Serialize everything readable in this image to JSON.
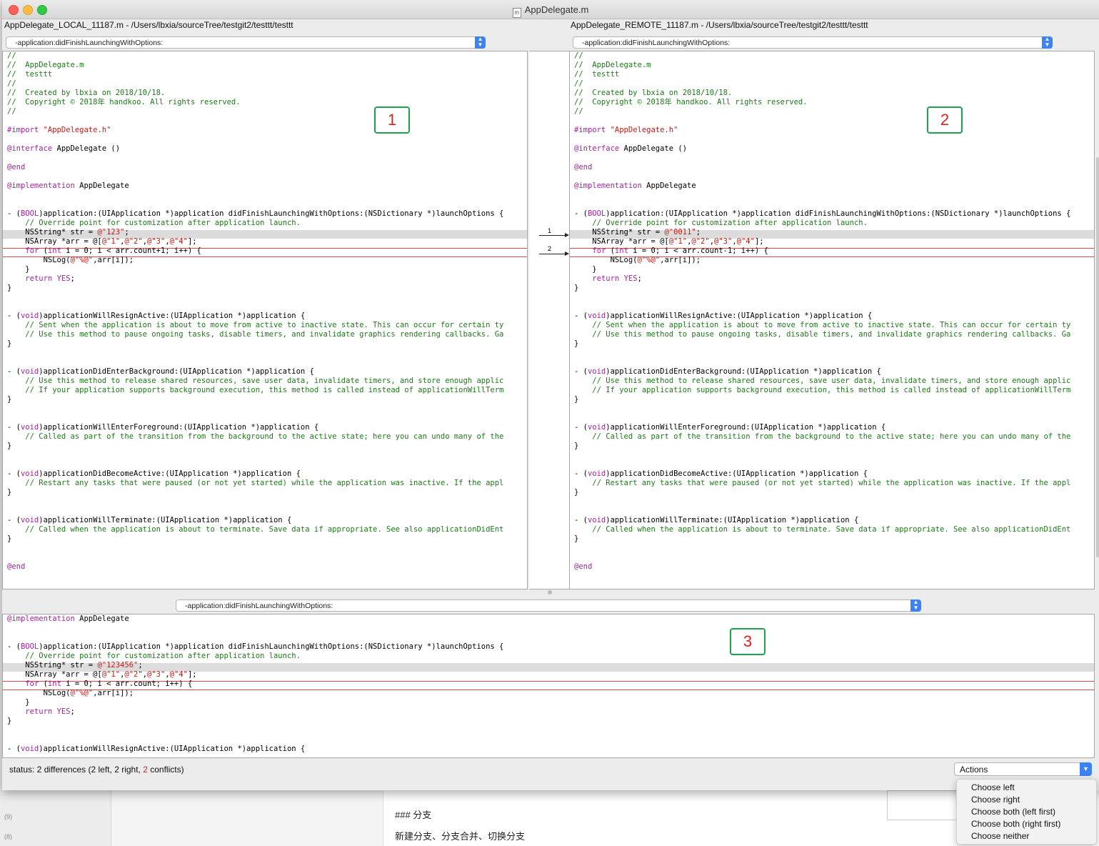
{
  "window": {
    "title": "AppDelegate.m",
    "doc_icon": "m"
  },
  "left": {
    "path": "AppDelegate_LOCAL_11187.m - /Users/lbxia/sourceTree/testgit2/testtt/testtt",
    "function_popup": "-application:didFinishLaunchingWithOptions:",
    "tag": "1"
  },
  "right": {
    "path": "AppDelegate_REMOTE_11187.m - /Users/lbxia/sourceTree/testgit2/testtt/testtt",
    "function_popup": "-application:didFinishLaunchingWithOptions:",
    "tag": "2"
  },
  "merge": {
    "function_popup": "-application:didFinishLaunchingWithOptions:",
    "tag": "3"
  },
  "gutter": {
    "diff1": "1",
    "diff2": "2"
  },
  "status": {
    "prefix": "status:  2 differences  (2 left,  2 right,  ",
    "conflicts": "2",
    "suffix": " conflicts)"
  },
  "actions": {
    "label": "Actions",
    "items": [
      "Choose left",
      "Choose right",
      "Choose both (left first)",
      "Choose both (right first)",
      "Choose neither"
    ]
  },
  "background": {
    "heading": "### 分支",
    "text": "新建分支、分支合并、切换分支",
    "side_count_1": "(9)",
    "side_count_2": "(8)"
  },
  "code_left": [
    "//",
    "//  AppDelegate.m",
    "//  testtt",
    "//",
    "//  Created by lbxia on 2018/10/18.",
    "//  Copyright © 2018年 handkoo. All rights reserved.",
    "//",
    "",
    "#import \"AppDelegate.h\"",
    "",
    "@interface AppDelegate ()",
    "",
    "@end",
    "",
    "@implementation AppDelegate",
    "",
    "",
    "- (BOOL)application:(UIApplication *)application didFinishLaunchingWithOptions:(NSDictionary *)launchOptions {",
    "    // Override point for customization after application launch.",
    "    NSString* str = @\"123\";",
    "    NSArray *arr = @[@\"1\",@\"2\",@\"3\",@\"4\"];",
    "    for (int i = 0; i < arr.count+1; i++) {",
    "        NSLog(@\"%@\",arr[i]);",
    "    }",
    "    return YES;",
    "}",
    "",
    "",
    "- (void)applicationWillResignActive:(UIApplication *)application {",
    "    // Sent when the application is about to move from active to inactive state. This can occur for certain ty",
    "    // Use this method to pause ongoing tasks, disable timers, and invalidate graphics rendering callbacks. Ga",
    "}",
    "",
    "",
    "- (void)applicationDidEnterBackground:(UIApplication *)application {",
    "    // Use this method to release shared resources, save user data, invalidate timers, and store enough applic",
    "    // If your application supports background execution, this method is called instead of applicationWillTerm",
    "}",
    "",
    "",
    "- (void)applicationWillEnterForeground:(UIApplication *)application {",
    "    // Called as part of the transition from the background to the active state; here you can undo many of the",
    "}",
    "",
    "",
    "- (void)applicationDidBecomeActive:(UIApplication *)application {",
    "    // Restart any tasks that were paused (or not yet started) while the application was inactive. If the appl",
    "}",
    "",
    "",
    "- (void)applicationWillTerminate:(UIApplication *)application {",
    "    // Called when the application is about to terminate. Save data if appropriate. See also applicationDidEnt",
    "}",
    "",
    "",
    "@end"
  ],
  "code_right": [
    "//",
    "//  AppDelegate.m",
    "//  testtt",
    "//",
    "//  Created by lbxia on 2018/10/18.",
    "//  Copyright © 2018年 handkoo. All rights reserved.",
    "//",
    "",
    "#import \"AppDelegate.h\"",
    "",
    "@interface AppDelegate ()",
    "",
    "@end",
    "",
    "@implementation AppDelegate",
    "",
    "",
    "- (BOOL)application:(UIApplication *)application didFinishLaunchingWithOptions:(NSDictionary *)launchOptions {",
    "    // Override point for customization after application launch.",
    "    NSString* str = @\"0011\";",
    "    NSArray *arr = @[@\"1\",@\"2\",@\"3\",@\"4\"];",
    "    for (int i = 0; i < arr.count-1; i++) {",
    "        NSLog(@\"%@\",arr[i]);",
    "    }",
    "    return YES;",
    "}",
    "",
    "",
    "- (void)applicationWillResignActive:(UIApplication *)application {",
    "    // Sent when the application is about to move from active to inactive state. This can occur for certain ty",
    "    // Use this method to pause ongoing tasks, disable timers, and invalidate graphics rendering callbacks. Ga",
    "}",
    "",
    "",
    "- (void)applicationDidEnterBackground:(UIApplication *)application {",
    "    // Use this method to release shared resources, save user data, invalidate timers, and store enough applic",
    "    // If your application supports background execution, this method is called instead of applicationWillTerm",
    "}",
    "",
    "",
    "- (void)applicationWillEnterForeground:(UIApplication *)application {",
    "    // Called as part of the transition from the background to the active state; here you can undo many of the",
    "}",
    "",
    "",
    "- (void)applicationDidBecomeActive:(UIApplication *)application {",
    "    // Restart any tasks that were paused (or not yet started) while the application was inactive. If the appl",
    "}",
    "",
    "",
    "- (void)applicationWillTerminate:(UIApplication *)application {",
    "    // Called when the application is about to terminate. Save data if appropriate. See also applicationDidEnt",
    "}",
    "",
    "",
    "@end"
  ],
  "code_merge": [
    "@implementation AppDelegate",
    "",
    "",
    "- (BOOL)application:(UIApplication *)application didFinishLaunchingWithOptions:(NSDictionary *)launchOptions {",
    "    // Override point for customization after application launch.",
    "    NSString* str = @\"123456\";",
    "    NSArray *arr = @[@\"1\",@\"2\",@\"3\",@\"4\"];",
    "    for (int i = 0; i < arr.count; i++) {",
    "        NSLog(@\"%@\",arr[i]);",
    "    }",
    "    return YES;",
    "}",
    "",
    "",
    "- (void)applicationWillResignActive:(UIApplication *)application {"
  ]
}
